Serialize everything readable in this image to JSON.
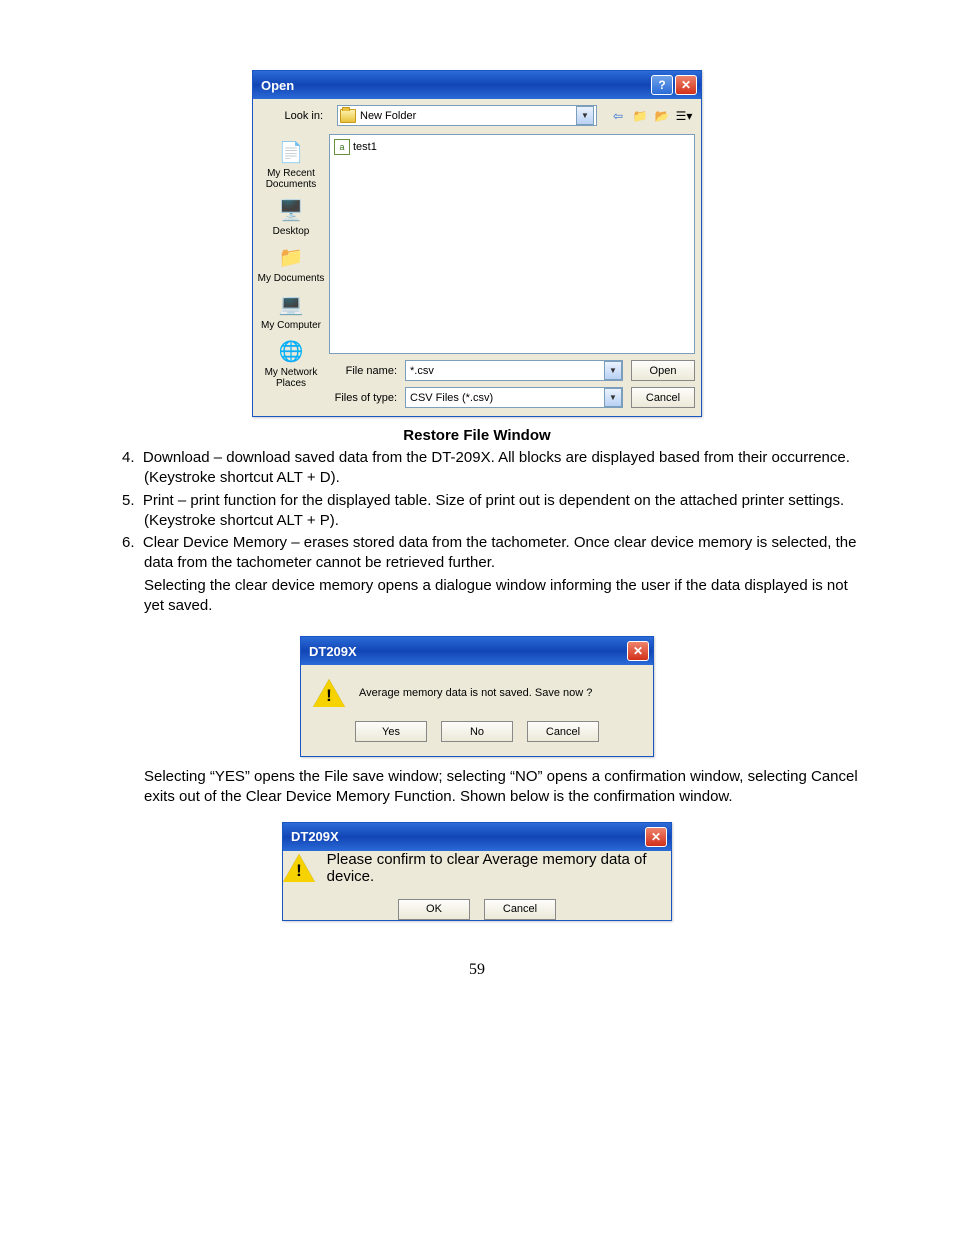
{
  "openDialog": {
    "title": "Open",
    "lookInLabel": "Look in:",
    "lookInValue": "New Folder",
    "places": [
      {
        "label": "My Recent Documents"
      },
      {
        "label": "Desktop"
      },
      {
        "label": "My Documents"
      },
      {
        "label": "My Computer"
      },
      {
        "label": "My Network Places"
      }
    ],
    "fileListed": "test1",
    "fileNameLabel": "File name:",
    "fileNameValue": "*.csv",
    "filesOfTypeLabel": "Files of type:",
    "filesOfTypeValue": "CSV Files (*.csv)",
    "openButton": "Open",
    "cancelButton": "Cancel"
  },
  "caption1": "Restore File Window",
  "list": {
    "n4": "4.",
    "t4": "Download – download saved data from the DT-209X. All blocks are displayed based from their occurrence.  (Keystroke shortcut ALT + D).",
    "n5": "5.",
    "t5": "Print – print function for the displayed table.  Size of print out is dependent on the attached printer settings. (Keystroke shortcut ALT + P).",
    "n6": "6.",
    "t6a": "Clear Device Memory – erases stored data from the tachometer. Once clear device memory is selected, the data from the tachometer cannot be retrieved further.",
    "t6b": "Selecting the clear device memory opens a dialogue window informing the user if the data displayed is not yet saved."
  },
  "msg1": {
    "title": "DT209X",
    "text": "Average memory data is not saved. Save now ?",
    "yes": "Yes",
    "no": "No",
    "cancel": "Cancel"
  },
  "para2": "Selecting “YES” opens the File save window; selecting “NO” opens a confirmation window, selecting Cancel exits out of the Clear Device Memory Function.  Shown below is the confirmation window.",
  "msg2": {
    "title": "DT209X",
    "text": "Please confirm to clear Average memory data of device.",
    "ok": "OK",
    "cancel": "Cancel"
  },
  "pageNumber": "59"
}
